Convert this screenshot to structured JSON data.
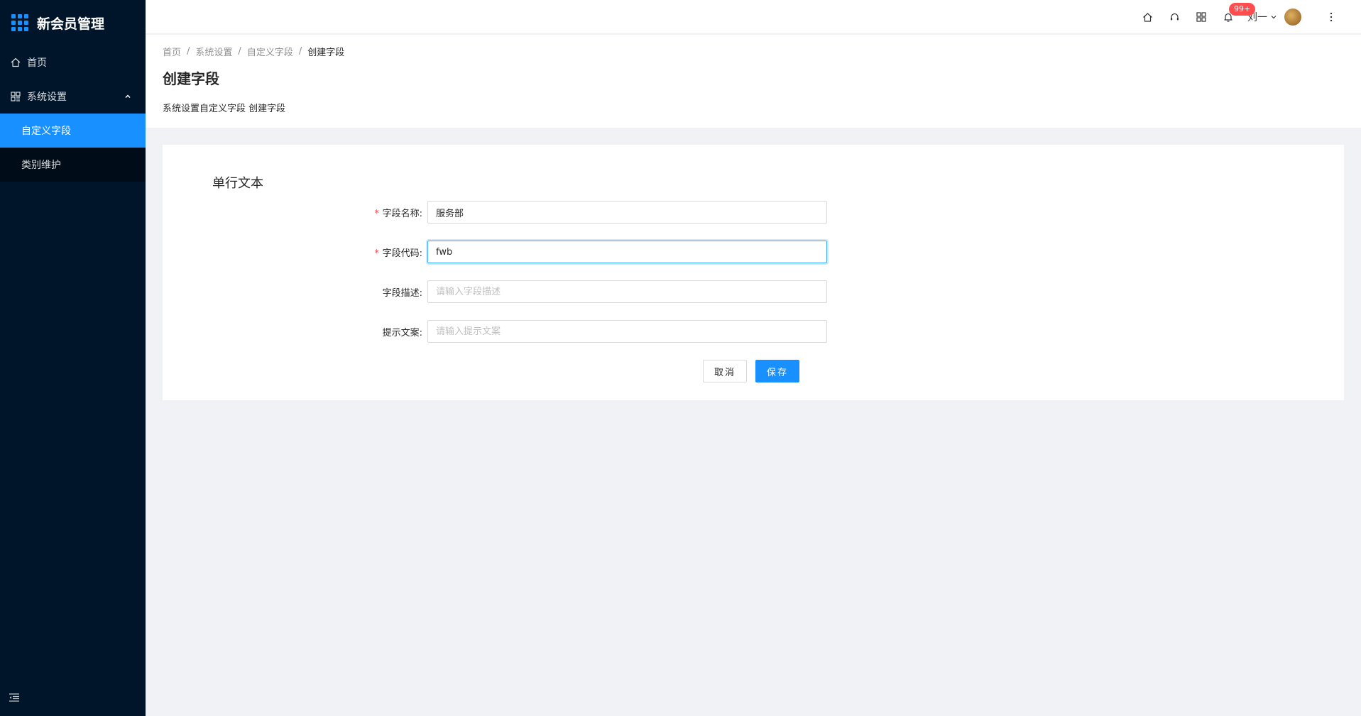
{
  "app": {
    "title": "新会员管理"
  },
  "sidebar": {
    "items": [
      {
        "label": "首页",
        "icon": "home-icon"
      },
      {
        "label": "系统设置",
        "icon": "settings-grid-icon",
        "expanded": true,
        "children": [
          {
            "label": "自定义字段",
            "active": true
          },
          {
            "label": "类别维护"
          }
        ]
      }
    ]
  },
  "header": {
    "notification_count": "99+",
    "user_name": "刘一"
  },
  "breadcrumb": [
    "首页",
    "系统设置",
    "自定义字段",
    "创建字段"
  ],
  "page": {
    "title": "创建字段",
    "description": "系统设置自定义字段 创建字段"
  },
  "form": {
    "section_title": "单行文本",
    "fields": [
      {
        "label": "字段名称:",
        "required": true,
        "value": "服务部",
        "placeholder": ""
      },
      {
        "label": "字段代码:",
        "required": true,
        "value": "fwb",
        "placeholder": ""
      },
      {
        "label": "字段描述:",
        "required": false,
        "value": "",
        "placeholder": "请输入字段描述"
      },
      {
        "label": "提示文案:",
        "required": false,
        "value": "",
        "placeholder": "请输入提示文案"
      }
    ],
    "cancel_label": "取消",
    "save_label": "保存"
  },
  "colors": {
    "sidebar_bg": "#001529",
    "accent": "#1890ff",
    "badge": "#ff4d4f"
  }
}
